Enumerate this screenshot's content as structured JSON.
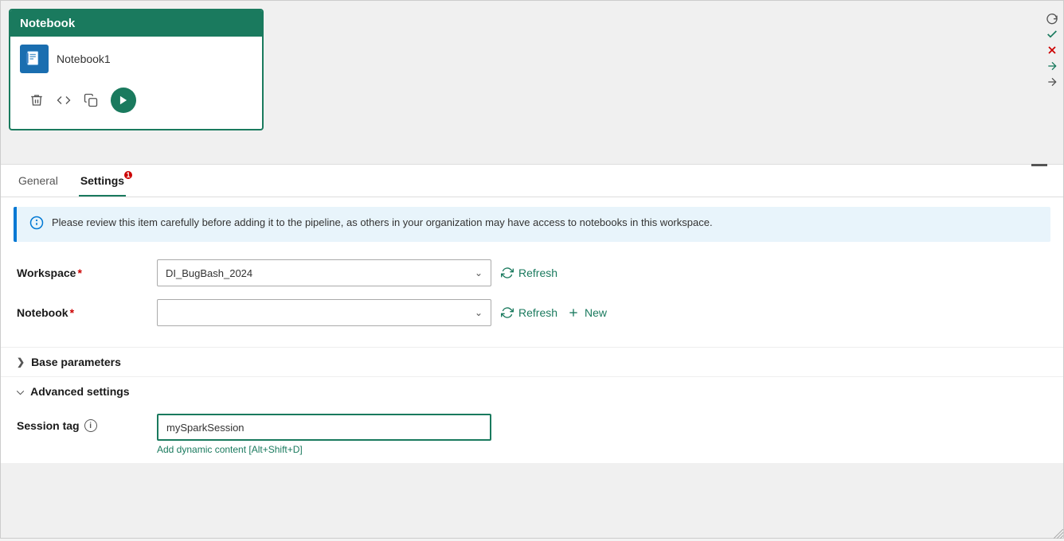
{
  "notebook_card": {
    "header_label": "Notebook",
    "item_name": "Notebook1",
    "actions": {
      "delete_label": "delete",
      "code_label": "code",
      "copy_label": "copy",
      "run_label": "run"
    }
  },
  "side_controls": {
    "redo_label": "redo",
    "check_label": "check",
    "close_label": "close",
    "arrow_right_label": "arrow-right",
    "arrow_right2_label": "arrow-right-2"
  },
  "tabs": {
    "general_label": "General",
    "settings_label": "Settings",
    "settings_badge": "1"
  },
  "info_banner": {
    "text": "Please review this item carefully before adding it to the pipeline, as others in your organization may have access to notebooks in this workspace."
  },
  "workspace_field": {
    "label": "Workspace",
    "required": "*",
    "value": "DI_BugBash_2024",
    "refresh_label": "Refresh"
  },
  "notebook_field": {
    "label": "Notebook",
    "required": "*",
    "value": "",
    "placeholder": "",
    "refresh_label": "Refresh",
    "new_label": "New"
  },
  "base_parameters": {
    "label": "Base parameters",
    "expanded": false
  },
  "advanced_settings": {
    "label": "Advanced settings",
    "expanded": true
  },
  "session_tag": {
    "label": "Session tag",
    "value": "mySparkSession",
    "dynamic_content_label": "Add dynamic content [Alt+Shift+D]"
  }
}
